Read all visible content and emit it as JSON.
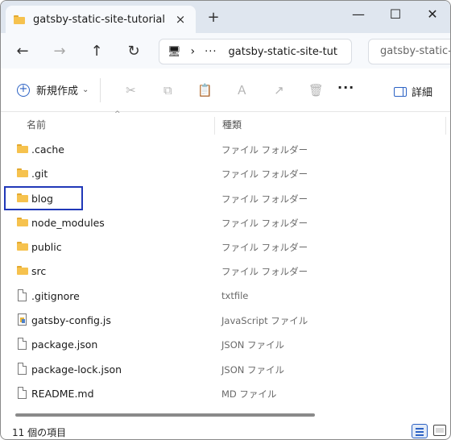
{
  "tab": {
    "title": "gatsby-static-site-tutorial",
    "close_icon": "×",
    "new_tab_icon": "+"
  },
  "window_controls": {
    "minimize": "—",
    "maximize": "☐",
    "close": "✕"
  },
  "nav": {
    "back": "←",
    "forward": "→",
    "up": "↑",
    "refresh": "↻",
    "address": {
      "computer_icon": "🖥",
      "separator": "›",
      "ellipsis": "···",
      "path": "gatsby-static-site-tut"
    },
    "search_placeholder": "gatsby-static-site-tutorial の検索"
  },
  "toolbar": {
    "new_label": "新規作成",
    "new_chevron": "⌄",
    "icons": [
      "✂",
      "⧉",
      "📋",
      "Ａ",
      "↗",
      "🗑"
    ],
    "more": "···",
    "details_label": "詳細"
  },
  "columns": {
    "name": "名前",
    "type": "種類",
    "sort_chevron": "^"
  },
  "files": [
    {
      "name": ".cache",
      "type": "ファイル フォルダー",
      "kind": "folder"
    },
    {
      "name": ".git",
      "type": "ファイル フォルダー",
      "kind": "folder"
    },
    {
      "name": "blog",
      "type": "ファイル フォルダー",
      "kind": "folder"
    },
    {
      "name": "node_modules",
      "type": "ファイル フォルダー",
      "kind": "folder"
    },
    {
      "name": "public",
      "type": "ファイル フォルダー",
      "kind": "folder"
    },
    {
      "name": "src",
      "type": "ファイル フォルダー",
      "kind": "folder"
    },
    {
      "name": ".gitignore",
      "type": "txtfile",
      "kind": "file"
    },
    {
      "name": "gatsby-config.js",
      "type": "JavaScript ファイル",
      "kind": "js"
    },
    {
      "name": "package.json",
      "type": "JSON ファイル",
      "kind": "file"
    },
    {
      "name": "package-lock.json",
      "type": "JSON ファイル",
      "kind": "file"
    },
    {
      "name": "README.md",
      "type": "MD ファイル",
      "kind": "file"
    }
  ],
  "status": {
    "count": "11 個の項目"
  },
  "colors": {
    "highlight": "#2038b8",
    "accent": "#2c62c4",
    "folder": "#f6c24e"
  }
}
